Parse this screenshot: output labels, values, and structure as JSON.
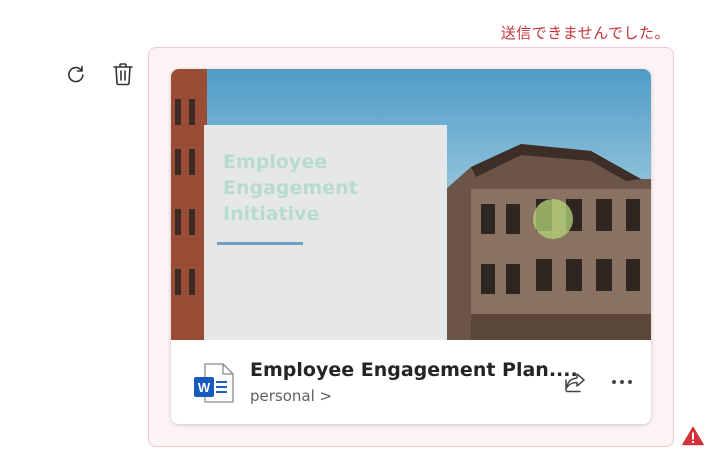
{
  "status": {
    "error_message": "送信できませんでした。",
    "error_color": "#c8323a"
  },
  "actions": {
    "retry_icon": "refresh-icon",
    "delete_icon": "trash-icon"
  },
  "attachment": {
    "thumbnail": {
      "slide_title": "Employee Engagement Initiative"
    },
    "file_name": "Employee Engagement Plan....",
    "location": "personal >",
    "file_type_icon": "word-document-icon",
    "share_icon": "share-icon",
    "more_icon": "more-options-icon"
  },
  "warning_icon": "warning-icon"
}
